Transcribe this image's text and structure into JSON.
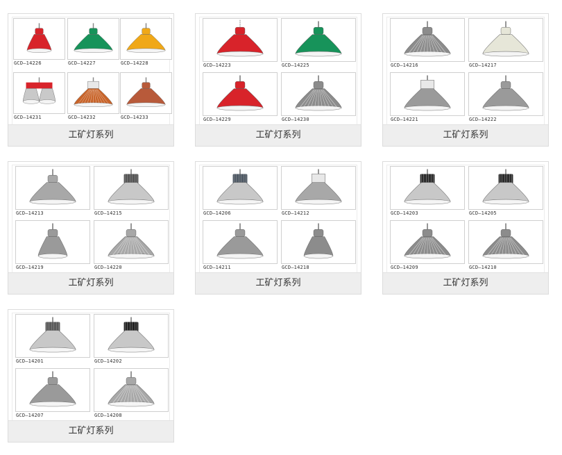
{
  "cards": [
    {
      "caption": "工矿灯系列",
      "items": [
        {
          "code": "GCD—14226",
          "color": "#d8232a",
          "icon": "red-conical-lamp-icon"
        },
        {
          "code": "GCD—14227",
          "color": "#17935a",
          "icon": "green-dome-lamp-icon"
        },
        {
          "code": "GCD—14228",
          "color": "#f0a818",
          "icon": "yellow-cage-lamp-icon"
        },
        {
          "code": "GCD—14231",
          "color": "#d8232a",
          "icon": "twin-head-lamp-icon"
        },
        {
          "code": "GCD—14232",
          "color": "#c8642a",
          "icon": "prism-box-lamp-icon"
        },
        {
          "code": "GCD—14233",
          "color": "#b85a3a",
          "icon": "flat-pendant-lamp-icon"
        }
      ]
    },
    {
      "caption": "工矿灯系列",
      "items": [
        {
          "code": "GCD—14223",
          "color": "#d8232a",
          "icon": "chain-pendant-lamp-icon"
        },
        {
          "code": "GCD—14225",
          "color": "#17935a",
          "icon": "green-highbay-lamp-icon"
        },
        {
          "code": "GCD—14229",
          "color": "#d8232a",
          "icon": "explosion-proof-lamp-icon"
        },
        {
          "code": "GCD—14230",
          "color": "#8c8c8c",
          "icon": "glass-dome-lamp-icon"
        }
      ]
    },
    {
      "caption": "工矿灯系列",
      "items": [
        {
          "code": "GCD—14216",
          "color": "#8c8c8c",
          "icon": "prismatic-highbay-icon"
        },
        {
          "code": "GCD—14217",
          "color": "#e6e6d8",
          "icon": "white-highbay-icon"
        },
        {
          "code": "GCD—14221",
          "color": "#9a9a9a",
          "icon": "box-driver-highbay-icon"
        },
        {
          "code": "GCD—14222",
          "color": "#9a9a9a",
          "icon": "aluminium-highbay-icon"
        }
      ]
    },
    {
      "caption": "工矿灯系列",
      "items": [
        {
          "code": "GCD—14213",
          "color": "#a8a8a8",
          "icon": "flat-reflector-lamp-icon"
        },
        {
          "code": "GCD—14215",
          "color": "#555555",
          "icon": "finned-highbay-icon"
        },
        {
          "code": "GCD—14219",
          "color": "#9a9a9a",
          "icon": "deep-bowl-lamp-icon"
        },
        {
          "code": "GCD—14220",
          "color": "#a8a8a8",
          "icon": "ribbed-reflector-lamp-icon"
        }
      ]
    },
    {
      "caption": "工矿灯系列",
      "items": [
        {
          "code": "GCD—14206",
          "color": "#4f5a66",
          "icon": "led-highbay-icon"
        },
        {
          "code": "GCD—14212",
          "color": "#a8a8a8",
          "icon": "gear-box-highbay-icon"
        },
        {
          "code": "GCD—14211",
          "color": "#9a9a9a",
          "icon": "wide-reflector-lamp-icon"
        },
        {
          "code": "GCD—14218",
          "color": "#8c8c8c",
          "icon": "narrow-beam-lamp-icon"
        }
      ]
    },
    {
      "caption": "工矿灯系列",
      "items": [
        {
          "code": "GCD—14203",
          "color": "#2b2b2b",
          "icon": "black-led-highbay-icon"
        },
        {
          "code": "GCD—14205",
          "color": "#2b2b2b",
          "icon": "black-heatsink-highbay-icon"
        },
        {
          "code": "GCD—14209",
          "color": "#8c8c8c",
          "icon": "faceted-reflector-lamp-icon"
        },
        {
          "code": "GCD—14210",
          "color": "#8c8c8c",
          "icon": "clear-prism-lamp-icon"
        }
      ]
    },
    {
      "caption": "工矿灯系列",
      "items": [
        {
          "code": "GCD—14201",
          "color": "#5a5a5a",
          "icon": "ufo-led-highbay-icon"
        },
        {
          "code": "GCD—14202",
          "color": "#222222",
          "icon": "dark-led-highbay-icon"
        },
        {
          "code": "GCD—14207",
          "color": "#9a9a9a",
          "icon": "wide-aluminium-reflector-icon"
        },
        {
          "code": "GCD—14208",
          "color": "#a8a8a8",
          "icon": "glass-prism-reflector-icon"
        }
      ]
    }
  ]
}
